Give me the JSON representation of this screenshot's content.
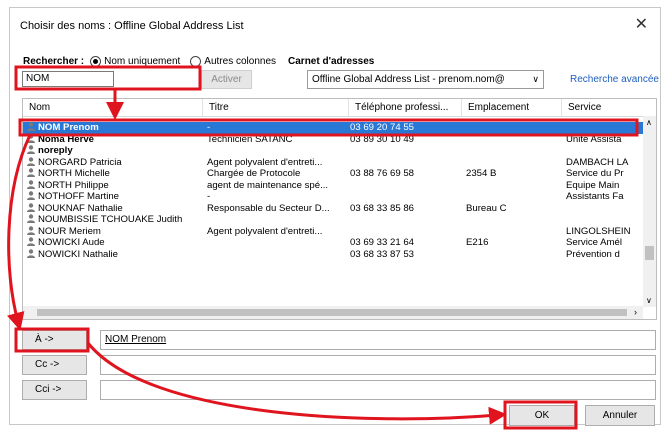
{
  "window": {
    "title": "Choisir des noms : Offline Global Address List",
    "close_glyph": "✕"
  },
  "search": {
    "label": "Rechercher :",
    "option_name": "Nom uniquement",
    "option_other": "Autres colonnes",
    "addressbook_label": "Carnet d'adresses",
    "value": "NOM",
    "activate_label": "Activer",
    "addressbook_value": "Offline Global Address List - prenom.nom@",
    "advanced_link": "Recherche avancée"
  },
  "table": {
    "columns": [
      "Nom",
      "Titre",
      "Téléphone professi...",
      "Emplacement",
      "Service"
    ],
    "rows": [
      {
        "name": "NOM Prenom",
        "title": "-",
        "phone": "03 69 20 74 55",
        "location": "",
        "service": ""
      },
      {
        "name": "Noma Hervé",
        "title": "Technicien SATANC",
        "phone": "03 89 30 10 49",
        "location": "",
        "service": "Unité Assista"
      },
      {
        "name": "noreply",
        "title": "",
        "phone": "",
        "location": "",
        "service": ""
      },
      {
        "name": "NORGARD Patricia",
        "title": "Agent polyvalent d'entreti...",
        "phone": "",
        "location": "",
        "service": "DAMBACH LA"
      },
      {
        "name": "NORTH Michelle",
        "title": "Chargée de Protocole",
        "phone": "03 88 76 69 58",
        "location": "2354 B",
        "service": "Service du Pr"
      },
      {
        "name": "NORTH Philippe",
        "title": "agent de maintenance spé...",
        "phone": "",
        "location": "",
        "service": "Equipe Main"
      },
      {
        "name": "NOTHOFF Martine",
        "title": "-",
        "phone": "",
        "location": "",
        "service": "Assistants Fa"
      },
      {
        "name": "NOUKNAF Nathalie",
        "title": "Responsable du Secteur D...",
        "phone": "03 68 33 85 86",
        "location": "Bureau C",
        "service": ""
      },
      {
        "name": "NOUMBISSIE TCHOUAKE Judith",
        "title": "",
        "phone": "",
        "location": "",
        "service": ""
      },
      {
        "name": "NOUR Meriem",
        "title": "Agent polyvalent d'entreti...",
        "phone": "",
        "location": "",
        "service": "LINGOLSHEIN"
      },
      {
        "name": "NOWICKI Aude",
        "title": "",
        "phone": "03 69 33 21 64",
        "location": "E216",
        "service": "Service Amél"
      },
      {
        "name": "NOWICKI Nathalie",
        "title": "",
        "phone": "03 68 33 87 53",
        "location": "",
        "service": "Prévention d"
      }
    ]
  },
  "recipients": {
    "to_label": "À ->",
    "to_value": "NOM Prenom",
    "cc_label": "Cc ->",
    "cc_value": "",
    "bcc_label": "Cci ->",
    "bcc_value": ""
  },
  "buttons": {
    "ok": "OK",
    "cancel": "Annuler"
  },
  "colors": {
    "selection": "#2a78d6",
    "highlight": "#e0141e",
    "link": "#1f5fbf"
  }
}
